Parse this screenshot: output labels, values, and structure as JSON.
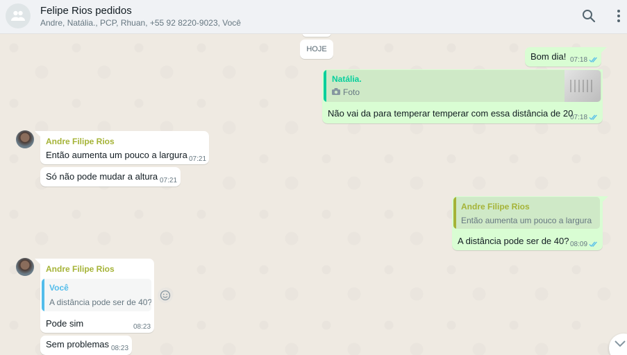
{
  "header": {
    "title": "Felipe Rios pedidos",
    "subtitle": "Andre, Natália., PCP, Rhuan, +55 92 8220-9023, Você",
    "search_icon": "search-icon",
    "menu_icon": "kebab-menu-icon"
  },
  "date_divider": "HOJE",
  "colors": {
    "header_bg": "#f0f2f5",
    "chat_bg": "#efeae2",
    "incoming_bubble": "#ffffff",
    "outgoing_bubble": "#d9fdd3",
    "read_ticks": "#53bdeb",
    "sender_andre": "#a5b337",
    "sender_natalia": "#06cf9c",
    "quote_voce": "#53bdeb"
  },
  "messages": [
    {
      "id": "m1",
      "dir": "out",
      "text": "Bom dia!",
      "time": "07:18",
      "status": "read"
    },
    {
      "id": "m2",
      "dir": "out",
      "reply": {
        "sender": "Natália.",
        "text": "Foto",
        "icon": "camera-icon",
        "has_thumbnail": true
      },
      "text": "Não vai da para temperar temperar com essa distância de 20",
      "time": "07:18",
      "status": "read"
    },
    {
      "id": "m3",
      "dir": "in",
      "sender": "Andre Filipe Rios",
      "text": "Então aumenta um pouco a largura",
      "time": "07:21"
    },
    {
      "id": "m4",
      "dir": "in",
      "text": "Só não pode mudar a altura",
      "time": "07:21"
    },
    {
      "id": "m5",
      "dir": "out",
      "reply": {
        "sender": "Andre Filipe Rios",
        "text": "Então aumenta um pouco a largura"
      },
      "text": "A distância pode ser de 40?",
      "time": "08:09",
      "status": "read"
    },
    {
      "id": "m6",
      "dir": "in",
      "sender": "Andre Filipe Rios",
      "reply": {
        "sender": "Você",
        "text": "A distância pode ser de 40?"
      },
      "text": "Pode sim",
      "time": "08:23"
    },
    {
      "id": "m7",
      "dir": "in",
      "text": "Sem problemas",
      "time": "08:23"
    }
  ]
}
